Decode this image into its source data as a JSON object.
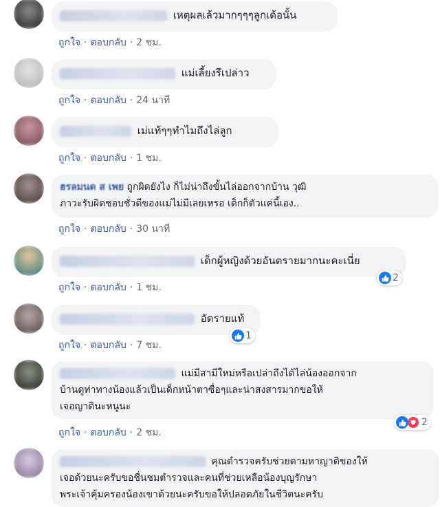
{
  "actions": {
    "like": "ถูกใจ",
    "reply": "ตอบกลับ",
    "separator": "·"
  },
  "comments": [
    {
      "avatar_color": "#4a4a4a",
      "text": "เหตุผลเล้วมากๆๆๆลูกเด้อนั้น",
      "time": "2 ชม."
    },
    {
      "avatar_color": "#cfcfcf",
      "text": "แม่เลี้ยงรึเปล่าว",
      "time": "24 นาที"
    },
    {
      "avatar_color": "#a37b83",
      "text": "เม่แท้ๆๆทำไมถึงไล่ลูก",
      "time": "1 ชม."
    },
    {
      "avatar_color": "#7b6a66",
      "name_partial": "ฮรลมนด ส เพย",
      "text_line1": "ถูกผิดยังไง ก็ไม่น่าถึงขั้นไล่ออกจากบ้าน วุฒิ",
      "text_line2": "ภาวะรับผิดชอบชั่วดีของแม่ไม่มีเลยเหรอ เด็กก็ตัวแค่นี้เอง..",
      "time": "30 นาที"
    },
    {
      "avatar_color": "#d99a55",
      "text": "เด็กผู้หญิงด้วยอันตรายมากนะคะเนี่ย",
      "time": "1 ชม.",
      "reactions": "2"
    },
    {
      "avatar_color": "#8a8080",
      "text": "อัตรายแท้",
      "time": "7 ชม.",
      "reactions": "1"
    },
    {
      "avatar_color": "#555a52",
      "text_line1": "แม่มีสามีใหม่หรือเปล่าถึงได้ไล่น้องออกจาก",
      "text_line2": "บ้านดูท่าทางน้องแล้วเป็นเด็กหน้าตาซื่อๆและน่าสงสารมากขอให้",
      "text_line3": "เจอญาตินะหนูนะ",
      "time": "2 ชม.",
      "reactions": "2"
    },
    {
      "avatar_color": "#b7a9c2",
      "text_line1": "คุณตำรวจครับช่วยตามหาญาติของให้",
      "text_line2": "เจอด้วยนะครับขอชื่นชมตำรวจและคนที่ช่วยเหลือน้องบุญรักษา",
      "text_line3": "พระเจ้าคุ้มครองน้องเขาด้วยนะครับขอให้ปลอดภัยในชีวิตนะครับ"
    }
  ]
}
